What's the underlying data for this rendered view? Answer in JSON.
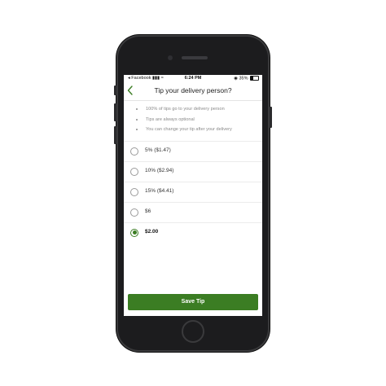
{
  "status_bar": {
    "back_app": "◂ Facebook",
    "time": "6:24 PM",
    "battery": "35%"
  },
  "header": {
    "title": "Tip your delivery person?"
  },
  "info": [
    "100% of tips go to your delivery person",
    "Tips are always optional",
    "You can change your tip after your delivery"
  ],
  "options": [
    {
      "label": "5% ($1.47)",
      "selected": false
    },
    {
      "label": "10% ($2.94)",
      "selected": false
    },
    {
      "label": "15% ($4.41)",
      "selected": false
    },
    {
      "label": "$6",
      "selected": false
    },
    {
      "label": "$2.00",
      "selected": true
    }
  ],
  "save_label": "Save Tip",
  "colors": {
    "accent": "#3b7d23",
    "phone_body": "#1c1c1e"
  }
}
